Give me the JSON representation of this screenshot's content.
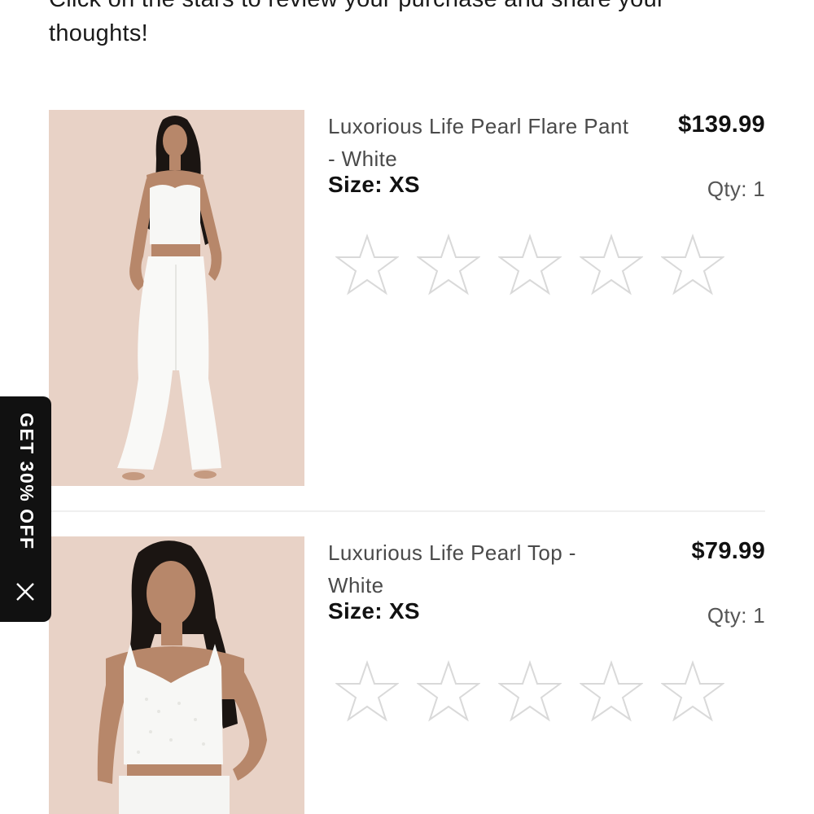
{
  "intro": {
    "text": "Click on the stars to review your purchase and share your thoughts!"
  },
  "products": [
    {
      "name": "Luxorious Life Pearl Flare Pant - White",
      "price": "$139.99",
      "size_label": "Size:",
      "size_value": "XS",
      "qty": "Qty: 1",
      "rating": 0,
      "max_rating": 5
    },
    {
      "name": "Luxurious Life Pearl Top - White",
      "price": "$79.99",
      "size_label": "Size:",
      "size_value": "XS",
      "qty": "Qty: 1",
      "rating": 0,
      "max_rating": 5
    }
  ],
  "promo": {
    "label": "GET 30% OFF",
    "close_icon": "close-icon"
  },
  "colors": {
    "promo_background": "#111111",
    "star_outline": "#d9d9d9",
    "photo_background": "#e9d3c8"
  }
}
